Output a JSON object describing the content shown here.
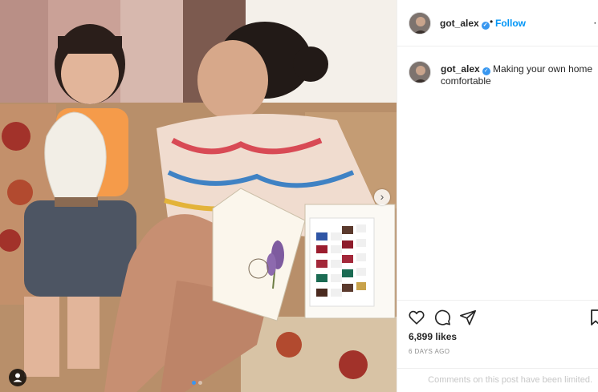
{
  "post": {
    "username": "got_alex",
    "follow_label": "Follow",
    "separator": "•",
    "caption": "Making your own home comfortable",
    "likes": "6,899 likes",
    "time_ago": "6 DAYS AGO",
    "comments_notice": "Comments on this post have been limited.",
    "carousel": {
      "current": 1,
      "total": 2
    }
  },
  "icons": {
    "next": "chevron-right-icon",
    "tag": "user-tag-icon",
    "like": "heart-icon",
    "comment": "comment-icon",
    "share": "paper-plane-icon",
    "save": "bookmark-icon",
    "verified": "verified-badge-icon",
    "more": "more-options-icon"
  },
  "glyphs": {
    "next": "›",
    "verified": "✓",
    "more": "⋯"
  },
  "colors": {
    "follow": "#0095f6",
    "verified": "#3897f0",
    "muted": "#8e8e8e"
  }
}
